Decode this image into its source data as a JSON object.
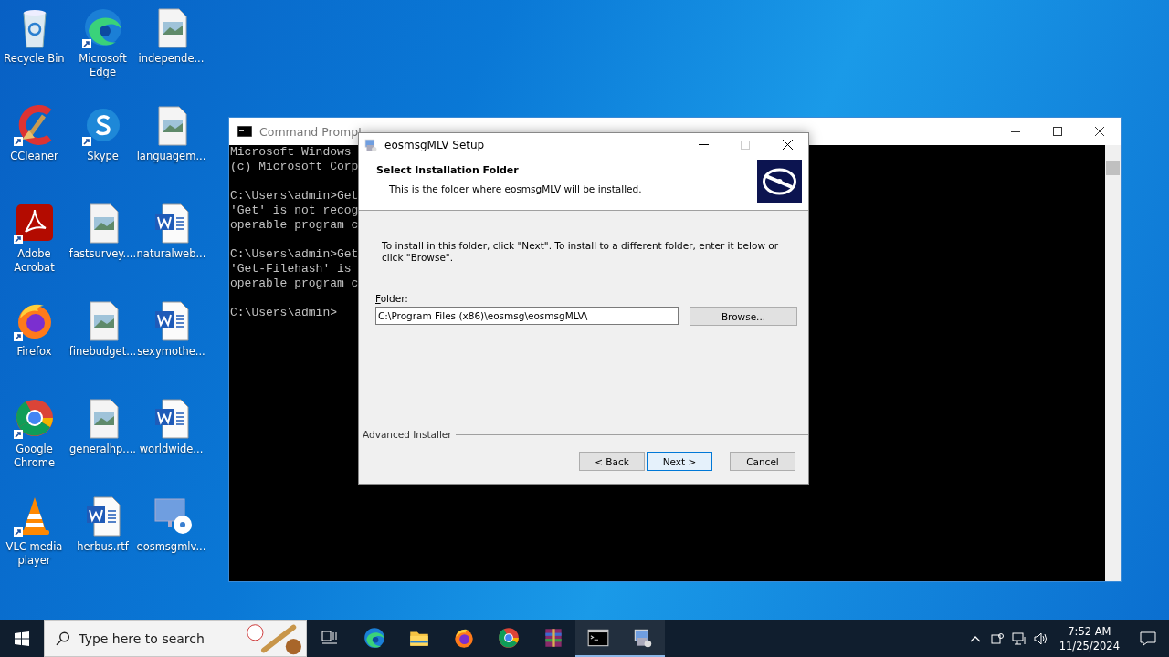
{
  "desktop": {
    "icons": [
      {
        "label": "Recycle Bin",
        "kind": "recycle",
        "shortcut": false
      },
      {
        "label": "Microsoft Edge",
        "kind": "edge",
        "shortcut": true
      },
      {
        "label": "independe...",
        "kind": "image",
        "shortcut": false
      },
      {
        "label": "CCleaner",
        "kind": "ccleaner",
        "shortcut": true
      },
      {
        "label": "Skype",
        "kind": "skype",
        "shortcut": true
      },
      {
        "label": "languagem...",
        "kind": "image",
        "shortcut": false
      },
      {
        "label": "Adobe Acrobat",
        "kind": "acrobat",
        "shortcut": true
      },
      {
        "label": "fastsurvey....",
        "kind": "image",
        "shortcut": false
      },
      {
        "label": "naturalweb...",
        "kind": "word",
        "shortcut": false
      },
      {
        "label": "Firefox",
        "kind": "firefox",
        "shortcut": true
      },
      {
        "label": "finebudget...",
        "kind": "image",
        "shortcut": false
      },
      {
        "label": "sexymothe...",
        "kind": "word",
        "shortcut": false
      },
      {
        "label": "Google Chrome",
        "kind": "chrome",
        "shortcut": true
      },
      {
        "label": "generalhp....",
        "kind": "image",
        "shortcut": false
      },
      {
        "label": "worldwide...",
        "kind": "word",
        "shortcut": false
      },
      {
        "label": "VLC media player",
        "kind": "vlc",
        "shortcut": true
      },
      {
        "label": "herbus.rtf",
        "kind": "word",
        "shortcut": false
      },
      {
        "label": "eosmsgmlv...",
        "kind": "installer",
        "shortcut": false
      }
    ]
  },
  "cmd_window": {
    "title": "Command Prompt",
    "blocks": [
      [
        "Microsoft Windows",
        "(c) Microsoft Corp"
      ],
      [
        "C:\\Users\\admin>Get",
        "'Get' is not recog",
        "operable program c"
      ],
      [
        "C:\\Users\\admin>Get",
        "'Get-Filehash' is",
        "operable program c"
      ],
      [
        "C:\\Users\\admin>"
      ]
    ]
  },
  "setup_dialog": {
    "title": "eosmsgMLV Setup",
    "heading": "Select Installation Folder",
    "subheading": "This is the folder where eosmsgMLV will be installed.",
    "instruction": "To install in this folder, click \"Next\". To install to a different folder, enter it below or click \"Browse\".",
    "folder_label": "Folder:",
    "folder_value": "C:\\Program Files (x86)\\eosmsg\\eosmsgMLV\\",
    "browse_button": "Browse...",
    "brand": "Advanced Installer",
    "buttons": [
      {
        "label": "< Back",
        "default": false
      },
      {
        "label": "Next >",
        "default": true
      },
      {
        "label": "Cancel",
        "default": false
      }
    ]
  },
  "taskbar": {
    "search": {
      "placeholder": "Type here to search"
    },
    "apps": [
      {
        "kind": "edge",
        "running": false
      },
      {
        "kind": "folder",
        "running": false
      },
      {
        "kind": "firefox",
        "running": false
      },
      {
        "kind": "chrome",
        "running": false
      },
      {
        "kind": "archive",
        "running": false
      },
      {
        "kind": "console",
        "running": true
      },
      {
        "kind": "installer",
        "running": true
      }
    ],
    "time": "7:52 AM",
    "date": "11/25/2024"
  }
}
